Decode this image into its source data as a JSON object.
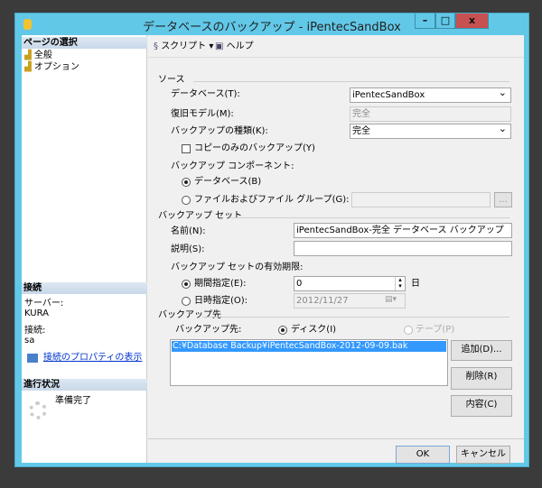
{
  "window": {
    "title": "データベースのバックアップ - iPentecSandBox",
    "minimize": "–",
    "maximize": "□",
    "close": "x"
  },
  "left": {
    "page_select_header": "ページの選択",
    "pages": [
      "全般",
      "オプション"
    ],
    "connection_header": "接続",
    "server_label": "サーバー:",
    "server": "KURA",
    "conn_label": "接続:",
    "conn": "sa",
    "view_props": "接続のプロパティの表示",
    "progress_header": "進行状況",
    "progress_status": "準備完了"
  },
  "toolbar": {
    "script": "スクリプト",
    "help": "ヘルプ"
  },
  "source": {
    "header": "ソース",
    "database_label": "データベース(T):",
    "database": "iPentecSandBox",
    "recovery_label": "復旧モデル(M):",
    "recovery": "完全",
    "type_label": "バックアップの種類(K):",
    "type": "完全",
    "copy_only": "コピーのみのバックアップ(Y)",
    "component_label": "バックアップ コンポーネント:",
    "comp_db": "データベース(B)",
    "comp_files": "ファイルおよびファイル グループ(G):",
    "browse": "..."
  },
  "set": {
    "header": "バックアップ セット",
    "name_label": "名前(N):",
    "name": "iPentecSandBox-完全 データベース バックアップ",
    "desc_label": "説明(S):",
    "desc": "",
    "expire_label": "バックアップ セットの有効期限:",
    "after_label": "期間指定(E):",
    "after_value": "0",
    "days": "日",
    "on_label": "日時指定(O):",
    "on_value": "2012/11/27"
  },
  "dest": {
    "header": "バックアップ先",
    "to_label": "バックアップ先:",
    "disk": "ディスク(I)",
    "tape": "テープ(P)",
    "files": [
      "C:¥Database Backup¥iPentecSandBox-2012-09-09.bak"
    ],
    "add": "追加(D)...",
    "remove": "削除(R)",
    "contents": "内容(C)"
  },
  "footer": {
    "ok": "OK",
    "cancel": "キャンセル"
  }
}
